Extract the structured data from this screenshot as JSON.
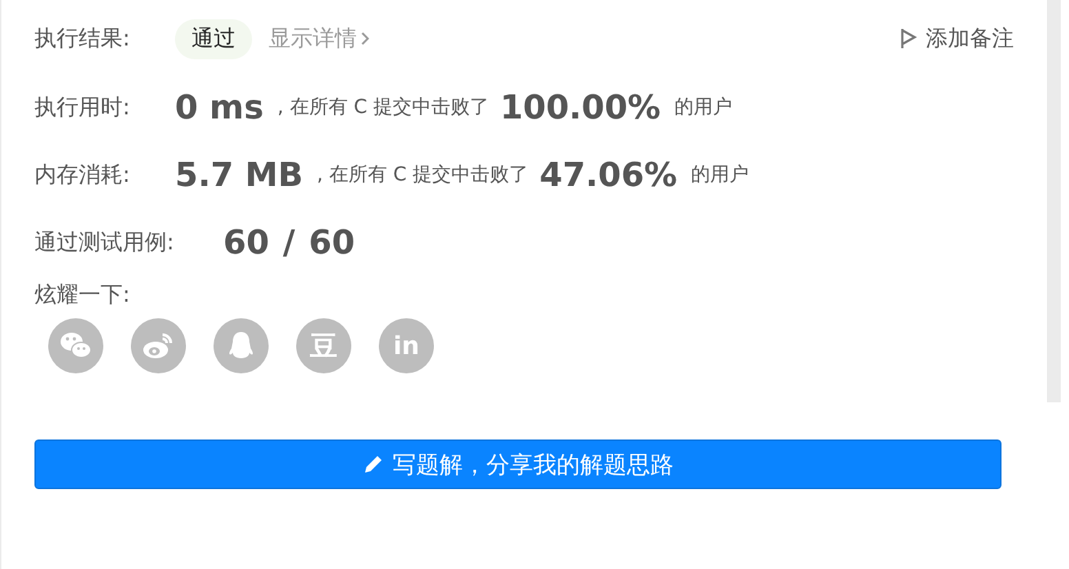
{
  "result": {
    "label": "执行结果:",
    "status": "通过",
    "details_link": "显示详情",
    "note_button": "添加备注"
  },
  "stats": [
    {
      "label": "执行用时:",
      "value": "0 ms",
      "middle": ", 在所有 C 提交中击败了",
      "percent": "100.00%",
      "suffix": "的用户"
    },
    {
      "label": "内存消耗:",
      "value": "5.7 MB",
      "middle": ", 在所有 C 提交中击败了",
      "percent": "47.06%",
      "suffix": "的用户"
    }
  ],
  "testcases": {
    "label": "通过测试用例:",
    "passed": "60",
    "separator": "/",
    "total": "60"
  },
  "share": {
    "label": "炫耀一下:",
    "icons": [
      {
        "kind": "wechat"
      },
      {
        "kind": "weibo"
      },
      {
        "kind": "qq"
      },
      {
        "kind": "douban",
        "text": "豆"
      },
      {
        "kind": "linkedin",
        "text": "in"
      }
    ]
  },
  "solution_button": "写题解，分享我的解题思路"
}
